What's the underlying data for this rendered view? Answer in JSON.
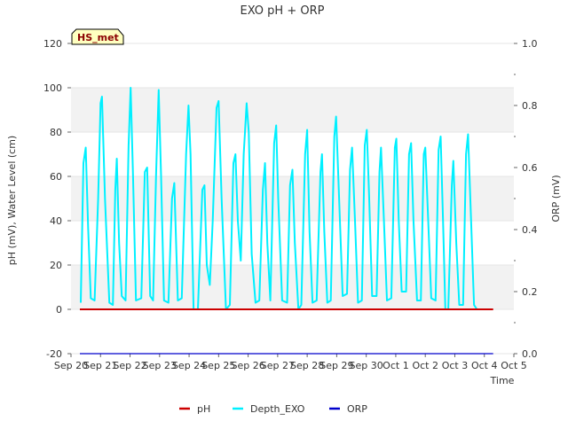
{
  "chart_data": {
    "type": "line",
    "title": "EXO pH + ORP",
    "xlabel": "Time",
    "ylabel": "pH (mV), Water Level (cm)",
    "y2label": "ORP (mV)",
    "station_badge": "HS_met",
    "xlim": [
      0,
      15
    ],
    "ylim": [
      -20,
      120
    ],
    "y2lim": [
      0.0,
      1.0
    ],
    "x_ticks": [
      {
        "v": 0,
        "label": "Sep 20"
      },
      {
        "v": 1,
        "label": "Sep 21"
      },
      {
        "v": 2,
        "label": "Sep 22"
      },
      {
        "v": 3,
        "label": "Sep 23"
      },
      {
        "v": 4,
        "label": "Sep 24"
      },
      {
        "v": 5,
        "label": "Sep 25"
      },
      {
        "v": 6,
        "label": "Sep 26"
      },
      {
        "v": 7,
        "label": "Sep 27"
      },
      {
        "v": 8,
        "label": "Sep 28"
      },
      {
        "v": 9,
        "label": "Sep 29"
      },
      {
        "v": 10,
        "label": "Sep 30"
      },
      {
        "v": 11,
        "label": "Oct 1"
      },
      {
        "v": 12,
        "label": "Oct 2"
      },
      {
        "v": 13,
        "label": "Oct 3"
      },
      {
        "v": 14,
        "label": "Oct 4"
      },
      {
        "v": 15,
        "label": "Oct 5"
      }
    ],
    "y_ticks": [
      -20,
      0,
      20,
      40,
      60,
      80,
      100,
      120
    ],
    "y2_ticks": [
      "0.0",
      "0.2",
      "0.4",
      "0.6",
      "0.8",
      "1.0"
    ],
    "legend_position": "bottom",
    "grid_bands": true,
    "series": [
      {
        "name": "pH",
        "color": "#cc0000",
        "axis": "left",
        "points": [
          [
            0.3,
            0
          ],
          [
            14.3,
            0
          ]
        ]
      },
      {
        "name": "Depth_EXO",
        "color": "#00f0ff",
        "axis": "left",
        "points": [
          [
            0.33,
            3
          ],
          [
            0.42,
            66
          ],
          [
            0.5,
            73
          ],
          [
            0.58,
            37
          ],
          [
            0.67,
            5
          ],
          [
            0.8,
            4
          ],
          [
            0.92,
            50
          ],
          [
            1.0,
            93
          ],
          [
            1.05,
            96
          ],
          [
            1.15,
            50
          ],
          [
            1.3,
            3
          ],
          [
            1.42,
            2
          ],
          [
            1.5,
            54
          ],
          [
            1.55,
            68
          ],
          [
            1.63,
            30
          ],
          [
            1.72,
            6
          ],
          [
            1.85,
            4
          ],
          [
            1.95,
            74
          ],
          [
            2.02,
            100
          ],
          [
            2.1,
            60
          ],
          [
            2.2,
            4
          ],
          [
            2.38,
            5
          ],
          [
            2.5,
            62
          ],
          [
            2.58,
            64
          ],
          [
            2.68,
            6
          ],
          [
            2.78,
            4
          ],
          [
            2.88,
            60
          ],
          [
            2.97,
            99
          ],
          [
            3.05,
            60
          ],
          [
            3.15,
            4
          ],
          [
            3.3,
            3
          ],
          [
            3.42,
            50
          ],
          [
            3.5,
            57
          ],
          [
            3.62,
            4
          ],
          [
            3.75,
            5
          ],
          [
            3.9,
            70
          ],
          [
            3.98,
            92
          ],
          [
            4.05,
            70
          ],
          [
            4.15,
            0
          ],
          [
            4.3,
            0
          ],
          [
            4.45,
            54
          ],
          [
            4.52,
            56
          ],
          [
            4.6,
            20
          ],
          [
            4.7,
            11
          ],
          [
            4.8,
            40
          ],
          [
            4.93,
            91
          ],
          [
            5.0,
            94
          ],
          [
            5.1,
            50
          ],
          [
            5.25,
            0
          ],
          [
            5.38,
            2
          ],
          [
            5.5,
            66
          ],
          [
            5.57,
            70
          ],
          [
            5.65,
            40
          ],
          [
            5.75,
            22
          ],
          [
            5.85,
            70
          ],
          [
            5.95,
            93
          ],
          [
            6.02,
            80
          ],
          [
            6.12,
            25
          ],
          [
            6.25,
            3
          ],
          [
            6.38,
            4
          ],
          [
            6.5,
            54
          ],
          [
            6.57,
            66
          ],
          [
            6.65,
            30
          ],
          [
            6.75,
            4
          ],
          [
            6.88,
            75
          ],
          [
            6.95,
            83
          ],
          [
            7.02,
            50
          ],
          [
            7.15,
            4
          ],
          [
            7.32,
            3
          ],
          [
            7.42,
            56
          ],
          [
            7.5,
            63
          ],
          [
            7.58,
            30
          ],
          [
            7.7,
            0
          ],
          [
            7.8,
            2
          ],
          [
            7.93,
            70
          ],
          [
            8.0,
            81
          ],
          [
            8.08,
            35
          ],
          [
            8.18,
            3
          ],
          [
            8.32,
            4
          ],
          [
            8.45,
            62
          ],
          [
            8.5,
            70
          ],
          [
            8.58,
            35
          ],
          [
            8.68,
            3
          ],
          [
            8.8,
            4
          ],
          [
            8.92,
            78
          ],
          [
            8.98,
            87
          ],
          [
            9.08,
            50
          ],
          [
            9.2,
            6
          ],
          [
            9.35,
            7
          ],
          [
            9.45,
            63
          ],
          [
            9.52,
            73
          ],
          [
            9.62,
            40
          ],
          [
            9.72,
            3
          ],
          [
            9.85,
            4
          ],
          [
            9.95,
            74
          ],
          [
            10.02,
            81
          ],
          [
            10.1,
            50
          ],
          [
            10.2,
            6
          ],
          [
            10.35,
            6
          ],
          [
            10.45,
            62
          ],
          [
            10.5,
            73
          ],
          [
            10.6,
            40
          ],
          [
            10.7,
            4
          ],
          [
            10.85,
            5
          ],
          [
            10.97,
            73
          ],
          [
            11.02,
            77
          ],
          [
            11.1,
            40
          ],
          [
            11.2,
            8
          ],
          [
            11.35,
            8
          ],
          [
            11.45,
            70
          ],
          [
            11.52,
            75
          ],
          [
            11.6,
            40
          ],
          [
            11.72,
            4
          ],
          [
            11.85,
            4
          ],
          [
            11.95,
            70
          ],
          [
            12.0,
            73
          ],
          [
            12.1,
            40
          ],
          [
            12.2,
            5
          ],
          [
            12.35,
            4
          ],
          [
            12.45,
            72
          ],
          [
            12.52,
            78
          ],
          [
            12.6,
            40
          ],
          [
            12.68,
            0
          ],
          [
            12.78,
            0
          ],
          [
            12.9,
            56
          ],
          [
            12.95,
            67
          ],
          [
            13.05,
            30
          ],
          [
            13.15,
            2
          ],
          [
            13.28,
            2
          ],
          [
            13.38,
            70
          ],
          [
            13.45,
            79
          ],
          [
            13.55,
            40
          ],
          [
            13.65,
            2
          ],
          [
            13.75,
            0
          ]
        ]
      },
      {
        "name": "ORP",
        "color": "#0000cc",
        "axis": "right",
        "points": [
          [
            0.3,
            0.0
          ],
          [
            14.3,
            0.0
          ]
        ]
      }
    ]
  }
}
